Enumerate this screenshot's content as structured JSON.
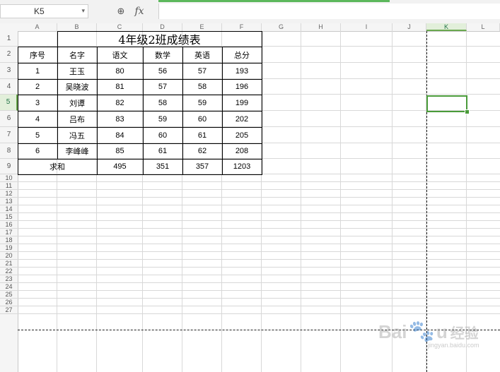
{
  "formula_bar": {
    "name_box": "K5",
    "name_box_dropdown": "▾",
    "zoom_glyph": "⊕",
    "fx_label": "fx",
    "formula_value": ""
  },
  "grid": {
    "columns": [
      "A",
      "B",
      "C",
      "D",
      "E",
      "F",
      "G",
      "H",
      "I",
      "J",
      "K",
      "L"
    ],
    "rows": [
      "1",
      "2",
      "3",
      "4",
      "5",
      "6",
      "7",
      "8",
      "9",
      "10",
      "11",
      "12",
      "13",
      "14",
      "15",
      "16",
      "17",
      "18",
      "19",
      "20",
      "21",
      "22",
      "23",
      "24",
      "25",
      "26",
      "27"
    ],
    "selected_cell": "K5"
  },
  "table": {
    "title": "4年级2班成绩表",
    "headers": [
      "序号",
      "名字",
      "语文",
      "数学",
      "英语",
      "总分"
    ],
    "rows": [
      [
        "1",
        "王玉",
        "80",
        "56",
        "57",
        "193"
      ],
      [
        "2",
        "吴晓波",
        "81",
        "57",
        "58",
        "196"
      ],
      [
        "3",
        "刘谭",
        "82",
        "58",
        "59",
        "199"
      ],
      [
        "4",
        "吕布",
        "83",
        "59",
        "60",
        "202"
      ],
      [
        "5",
        "冯五",
        "84",
        "60",
        "61",
        "205"
      ],
      [
        "6",
        "李峰峰",
        "85",
        "61",
        "62",
        "208"
      ]
    ],
    "sum_label": "求和",
    "sums": [
      "495",
      "351",
      "357",
      "1203"
    ]
  },
  "watermark": {
    "brand": "Bai",
    "paw": "🐾",
    "brand_end": "u",
    "cn": "经验",
    "sub": "jingyan.baidu.com"
  },
  "colors": {
    "selection": "#4a9b3a",
    "header_bg": "#f5f5f5",
    "gridline": "#d8d8d8"
  }
}
